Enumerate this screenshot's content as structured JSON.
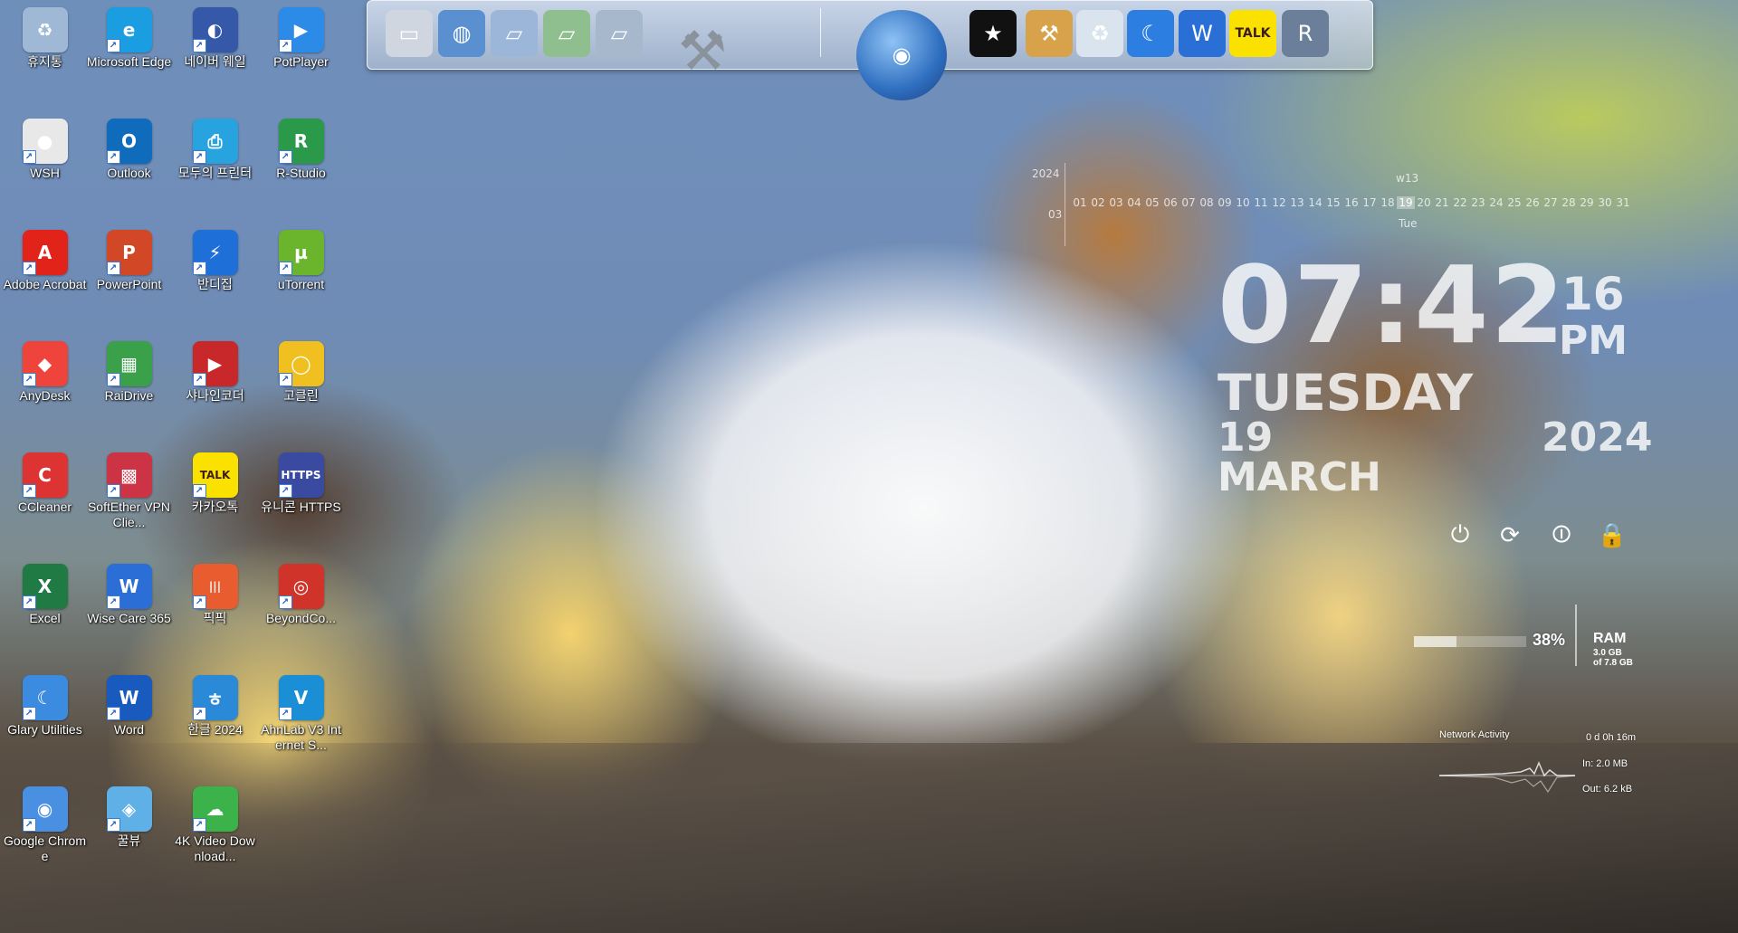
{
  "desktop": {
    "icons": [
      {
        "label": "휴지통",
        "icon": "recycle-bin-icon",
        "color": "#9fb8d6",
        "glyph": "♻"
      },
      {
        "label": "WSH",
        "icon": "wsh-icon",
        "color": "#e8e8e8",
        "glyph": "●"
      },
      {
        "label": "Adobe Acrobat",
        "icon": "adobe-acrobat-icon",
        "color": "#e2231a",
        "glyph": "A"
      },
      {
        "label": "AnyDesk",
        "icon": "anydesk-icon",
        "color": "#ef443b",
        "glyph": "◆"
      },
      {
        "label": "CCleaner",
        "icon": "ccleaner-icon",
        "color": "#d33",
        "glyph": "C"
      },
      {
        "label": "Excel",
        "icon": "excel-icon",
        "color": "#1f7a43",
        "glyph": "X"
      },
      {
        "label": "Glary Utilities",
        "icon": "glary-utilities-icon",
        "color": "#3b8be0",
        "glyph": "☾"
      },
      {
        "label": "Google Chrome",
        "icon": "chrome-icon",
        "color": "#4a90e2",
        "glyph": "◉"
      },
      {
        "label": "Microsoft Edge",
        "icon": "edge-icon",
        "color": "#1b9de2",
        "glyph": "e"
      },
      {
        "label": "Outlook",
        "icon": "outlook-icon",
        "color": "#0f6cbd",
        "glyph": "O"
      },
      {
        "label": "PowerPoint",
        "icon": "powerpoint-icon",
        "color": "#d24726",
        "glyph": "P"
      },
      {
        "label": "RaiDrive",
        "icon": "raidrive-icon",
        "color": "#3aa04a",
        "glyph": "▦"
      },
      {
        "label": "SoftEther VPN Clie...",
        "icon": "softether-icon",
        "color": "#cc3344",
        "glyph": "▩"
      },
      {
        "label": "Wise Care 365",
        "icon": "wise-care-icon",
        "color": "#2b6fd6",
        "glyph": "W"
      },
      {
        "label": "Word",
        "icon": "word-icon",
        "color": "#185abd",
        "glyph": "W"
      },
      {
        "label": "꿀뷰",
        "icon": "honeyview-icon",
        "color": "#5fb0e6",
        "glyph": "◈"
      },
      {
        "label": "네이버 웨일",
        "icon": "naver-whale-icon",
        "color": "#3559a8",
        "glyph": "◐"
      },
      {
        "label": "모두의 프린터",
        "icon": "printer-icon",
        "color": "#27a3e0",
        "glyph": "⎙"
      },
      {
        "label": "반디집",
        "icon": "bandizip-icon",
        "color": "#1e6fd8",
        "glyph": "⚡"
      },
      {
        "label": "샤나인코더",
        "icon": "shana-encoder-icon",
        "color": "#c8282a",
        "glyph": "▶"
      },
      {
        "label": "카카오톡",
        "icon": "kakaotalk-icon",
        "color": "#fae100",
        "glyph": "TALK"
      },
      {
        "label": "픽픽",
        "icon": "picpick-icon",
        "color": "#e85c2f",
        "glyph": "|||"
      },
      {
        "label": "한글 2024",
        "icon": "hangul-icon",
        "color": "#2a8ad8",
        "glyph": "ㅎ"
      },
      {
        "label": "4K Video Download...",
        "icon": "4k-video-downloader-icon",
        "color": "#3bb34a",
        "glyph": "☁"
      },
      {
        "label": "PotPlayer",
        "icon": "potplayer-icon",
        "color": "#2b8be6",
        "glyph": "▶"
      },
      {
        "label": "R-Studio",
        "icon": "r-studio-icon",
        "color": "#2a9a4a",
        "glyph": "R"
      },
      {
        "label": "uTorrent",
        "icon": "utorrent-icon",
        "color": "#6bb52d",
        "glyph": "µ"
      },
      {
        "label": "고클린",
        "icon": "goclean-icon",
        "color": "#f0c020",
        "glyph": "◯"
      },
      {
        "label": "유니콘 HTTPS",
        "icon": "unicorn-https-icon",
        "color": "#3a4aa0",
        "glyph": "HTTPS"
      },
      {
        "label": "BeyondCo...",
        "icon": "beyond-compare-icon",
        "color": "#d0332a",
        "glyph": "◎"
      },
      {
        "label": "AhnLab V3 Internet S...",
        "icon": "ahnlab-v3-icon",
        "color": "#1a8fd6",
        "glyph": "V"
      }
    ]
  },
  "dock": {
    "items": [
      {
        "name": "monitor-icon",
        "color": "#cfd6e0",
        "glyph": "▭"
      },
      {
        "name": "network-globe-icon",
        "color": "#5a8fd0",
        "glyph": "◍"
      },
      {
        "name": "folder-icon",
        "color": "#9bb6d8",
        "glyph": "▱"
      },
      {
        "name": "folder-sync-icon",
        "color": "#8fbf8f",
        "glyph": "▱"
      },
      {
        "name": "folder-open-icon",
        "color": "#a8b8cc",
        "glyph": "▱"
      },
      {
        "name": "tools-icon",
        "color": "#9aa3ad",
        "glyph": "⚒"
      },
      {
        "name": "globe-icon",
        "color": "#3f7fd0",
        "glyph": "◉"
      },
      {
        "name": "tshirt-icon",
        "color": "#111111",
        "glyph": "★"
      },
      {
        "name": "hammer-icon",
        "color": "#d8a24a",
        "glyph": "⚒"
      },
      {
        "name": "recycle-bin-icon",
        "color": "#d9e4ee",
        "glyph": "♻"
      },
      {
        "name": "glary-moon-icon",
        "color": "#2c7fe0",
        "glyph": "☾"
      },
      {
        "name": "wise-shield-icon",
        "color": "#2a6fd6",
        "glyph": "W"
      },
      {
        "name": "kakaotalk-icon",
        "color": "#fae100",
        "glyph": "TALK"
      },
      {
        "name": "r-studio-icon",
        "color": "#6b7f9a",
        "glyph": "R"
      }
    ]
  },
  "calendar": {
    "year": "2024",
    "month": "03",
    "week": "w13",
    "weekday": "Tue",
    "today": "19",
    "days": [
      "01",
      "02",
      "03",
      "04",
      "05",
      "06",
      "07",
      "08",
      "09",
      "10",
      "11",
      "12",
      "13",
      "14",
      "15",
      "16",
      "17",
      "18",
      "19",
      "20",
      "21",
      "22",
      "23",
      "24",
      "25",
      "26",
      "27",
      "28",
      "29",
      "30",
      "31"
    ]
  },
  "clock": {
    "time": "07:42",
    "seconds": "16",
    "ampm": "PM",
    "day": "TUESDAY",
    "date": "19 MARCH",
    "year": "2024"
  },
  "power": {
    "items": [
      {
        "name": "shutdown-icon",
        "glyph": "⏻"
      },
      {
        "name": "restart-icon",
        "glyph": "⟳"
      },
      {
        "name": "logoff-icon",
        "glyph": "⏼"
      },
      {
        "name": "lock-icon",
        "glyph": "🔒"
      }
    ]
  },
  "ram": {
    "percent_text": "38%",
    "percent": 0.38,
    "title": "RAM",
    "used": "3.0 GB",
    "total": "of 7.8 GB"
  },
  "network": {
    "title": "Network Activity",
    "uptime": "0 d 0h 16m",
    "in": "In: 2.0 MB",
    "out": "Out: 6.2 kB"
  }
}
